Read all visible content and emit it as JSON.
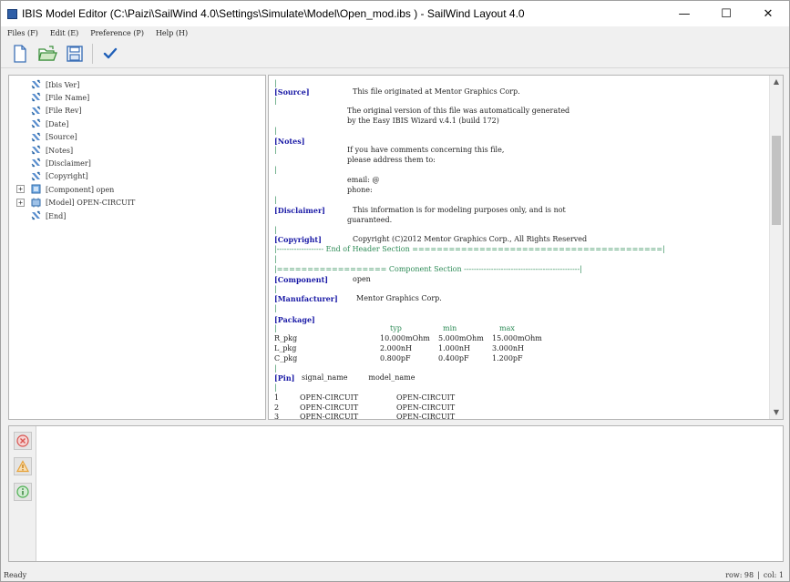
{
  "window": {
    "title": "IBIS Model Editor (C:\\Paizi\\SailWind 4.0\\Settings\\Simulate\\Model\\Open_mod.ibs  ) - SailWind Layout 4.0",
    "minimize_glyph": "—",
    "maximize_glyph": "☐",
    "close_glyph": "✕"
  },
  "menu": [
    "Files (F)",
    "Edit (E)",
    "Preference (P)",
    "Help (H)"
  ],
  "toolbar": {
    "icons": [
      "new-file-icon",
      "open-folder-icon",
      "save-icon",
      "check-icon"
    ]
  },
  "tree": {
    "items": [
      {
        "label": "[Ibis Ver]",
        "expandable": false,
        "icon": "ibis-keyword-icon"
      },
      {
        "label": "[File Name]",
        "expandable": false,
        "icon": "ibis-keyword-icon"
      },
      {
        "label": "[File Rev]",
        "expandable": false,
        "icon": "ibis-keyword-icon"
      },
      {
        "label": "[Date]",
        "expandable": false,
        "icon": "ibis-keyword-icon"
      },
      {
        "label": "[Source]",
        "expandable": false,
        "icon": "ibis-keyword-icon"
      },
      {
        "label": "[Notes]",
        "expandable": false,
        "icon": "ibis-keyword-icon"
      },
      {
        "label": "[Disclaimer]",
        "expandable": false,
        "icon": "ibis-keyword-icon"
      },
      {
        "label": "[Copyright]",
        "expandable": false,
        "icon": "ibis-keyword-icon"
      },
      {
        "label": "[Component] open",
        "expandable": true,
        "icon": "component-icon"
      },
      {
        "label": "[Model] OPEN-CIRCUIT",
        "expandable": true,
        "icon": "model-icon"
      },
      {
        "label": "[End]",
        "expandable": false,
        "icon": "ibis-keyword-icon"
      }
    ],
    "expander_glyph": "+"
  },
  "editor": {
    "source_kw": "[Source]",
    "source_text": "This file originated at Mentor Graphics Corp.",
    "source_l2": "The original version of this file was automatically generated",
    "source_l3": "by the Easy IBIS Wizard v.4.1 (build 172)",
    "notes_kw": "[Notes]",
    "notes_l1": "If you have comments concerning this file,",
    "notes_l2": "please address them to:",
    "notes_l3": "email: @",
    "notes_l4": "phone:",
    "disclaimer_kw": "[Disclaimer]",
    "disclaimer_l1": "This information is for modeling purposes only, and is not",
    "disclaimer_l2": "guaranteed.",
    "copyright_kw": "[Copyright]",
    "copyright_text": "Copyright (C)2012 Mentor Graphics Corp., All Rights Reserved",
    "end_header": "|------------------- End of Header Section =========================================|",
    "component_section": "|================== Component Section -----------------------------------------------|",
    "component_kw": "[Component]",
    "component_val": "open",
    "manufacturer_kw": "[Manufacturer]",
    "manufacturer_val": "Mentor Graphics Corp.",
    "package_kw": "[Package]",
    "pkg_header_typ": "typ",
    "pkg_header_min": "min",
    "pkg_header_max": "max",
    "pkg_rows": [
      {
        "name": "R_pkg",
        "typ": "10.000mOhm",
        "min": "5.000mOhm",
        "max": "15.000mOhm"
      },
      {
        "name": "L_pkg",
        "typ": "2.000nH",
        "min": "1.000nH",
        "max": "3.000nH"
      },
      {
        "name": "C_pkg",
        "typ": "0.800pF",
        "min": "0.400pF",
        "max": "1.200pF"
      }
    ],
    "pin_kw": "[Pin]",
    "pin_cols": "signal_name         model_name",
    "pin_rows": [
      {
        "num": "1",
        "signal": "OPEN-CIRCUIT",
        "model": "OPEN-CIRCUIT"
      },
      {
        "num": "2",
        "signal": "OPEN-CIRCUIT",
        "model": "OPEN-CIRCUIT"
      },
      {
        "num": "3",
        "signal": "OPEN-CIRCUIT",
        "model": "OPEN-CIRCUIT"
      }
    ],
    "bar_char": "|"
  },
  "scrollbar": {
    "up_glyph": "▲",
    "down_glyph": "▼"
  },
  "messages": {
    "filters": [
      "error-filter-icon",
      "warning-filter-icon",
      "info-filter-icon"
    ]
  },
  "status": {
    "left": "Ready",
    "row_label": "row: 98",
    "col_label": "col: 1"
  },
  "colors": {
    "keyword": "#1a1aa6",
    "section_rule": "#2e8b57",
    "error": "#d9534f",
    "warning": "#e8a33a",
    "info": "#4caf50"
  }
}
